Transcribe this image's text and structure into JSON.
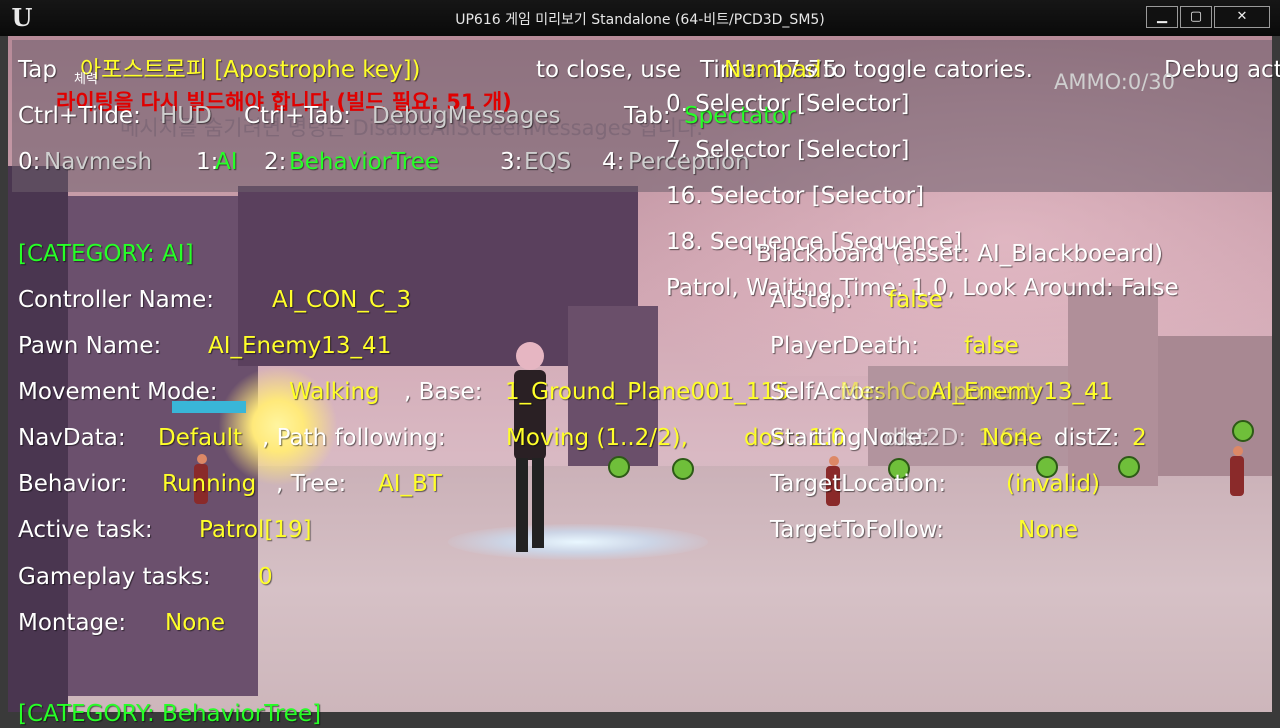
{
  "window": {
    "logo": "U",
    "title": "UP616 게임 미리보기 Standalone (64-비트/PCD3D_SM5)",
    "buttons": {
      "minimize": "▁",
      "maximize": "▢",
      "close": "✕"
    }
  },
  "debug_header": {
    "tap": "Tap",
    "apostrophe_key": "아포스트로피 [Apostrophe key])",
    "to_close": "to close, use",
    "time": "Time: 17.75",
    "numpad": "Numpad",
    "s_toggle": "s  to toggle catories.",
    "debug_act": "Debug act",
    "ammo": "AMMO:0/30",
    "small_label": "체력",
    "rebuild_warning": "라이팅을 다시 빌드해야 합니다 (빌드 필요: 51 개)",
    "ctrl_tilde": "Ctrl+Tilde:",
    "hud": "HUD",
    "ctrl_tab": "Ctrl+Tab:",
    "debug_messages": "DebugMessages",
    "faint_message": "메시지를 숨기려면 명령은 DisableAllScreenMessages 입니다.",
    "tab_label": "Tab:",
    "spectator": "Spectator"
  },
  "categories": [
    {
      "key": "0:",
      "name": "Navmesh",
      "active": false
    },
    {
      "key": "1:",
      "name": "AI",
      "active": true
    },
    {
      "key": "2:",
      "name": "BehaviorTree",
      "active": true
    },
    {
      "key": "3:",
      "name": "EQS",
      "active": false
    },
    {
      "key": "4:",
      "name": "Perception",
      "active": false
    }
  ],
  "ai": {
    "category_header": "[CATEGORY: AI]",
    "controller_label": "Controller Name:",
    "controller_value": "AI_CON_C_3",
    "pawn_label": "Pawn Name:",
    "pawn_value": "AI_Enemy13_41",
    "movement_label": "Movement Mode:",
    "movement_value": "Walking",
    "base_label": ", Base:",
    "base_value": "1_Ground_Plane001_115",
    "navdata_label": "NavData:",
    "navdata_value": "Default",
    "path_label": ", Path following:",
    "path_value": "Moving (1..2/2),",
    "dist_value": "dost: 1.0",
    "behavior_label": "Behavior:",
    "behavior_value": "Running",
    "tree_label": ", Tree:",
    "tree_value": "AI_BT",
    "active_task_label": "Active task:",
    "active_task_value": "Patrol[19]",
    "gameplay_tasks_label": "Gameplay tasks:",
    "gameplay_tasks_value": "0",
    "montage_label": "Montage:",
    "montage_value": "None",
    "bottom_header": "[CATEGORY: BehaviorTree]"
  },
  "behavior_tree": {
    "nodes": [
      "0. Selector [Selector]",
      "7. Selector [Selector]",
      "16. Selector [Selector]",
      "18. Sequence [Sequence]"
    ],
    "patrol": "Patrol, Waiting Time: 1.0, Look Around: False"
  },
  "blackboard": {
    "header": "Blackboard (asset: AI_Blackboeard)",
    "aistop_label": "AIStop:",
    "aistop_value": "false",
    "playerdeath_label": "PlayerDeath:",
    "playerdeath_value": "false",
    "selfactor_label": "SelfActor:",
    "selfactor_value": "AI_Enemy13_41",
    "startingnode_label": "StartingNode:",
    "startingnode_value": "None",
    "overlap_mesh": "MeshComponent",
    "overlap_dist2d": "dist2D:",
    "overlap_value": "1.64",
    "distz_label": "distZ:",
    "distz_value": "2",
    "targetlocation_label": "TargetLocation:",
    "targetlocation_value": "(invalid)",
    "targettofollow_label": "TargetToFollow:",
    "targettofollow_value": "None"
  }
}
